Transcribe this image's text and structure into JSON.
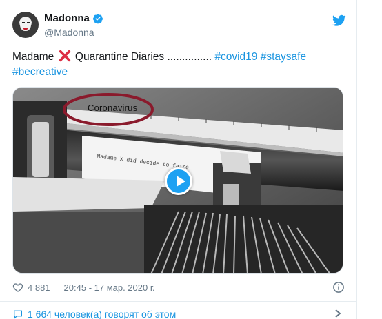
{
  "author": {
    "display_name": "Madonna",
    "handle": "@Madonna",
    "verified": true
  },
  "tweet": {
    "text_before": "Madame ",
    "text_after": " Quarantine Diaries ............... ",
    "hashtags": [
      "#covid19",
      "#staysafe",
      "#becreative"
    ]
  },
  "media": {
    "type": "video",
    "typed_label": "Coronavirus",
    "paper_text": "Madame X did decide to faire"
  },
  "meta": {
    "likes": "4 881",
    "timestamp": "20:45 - 17 мар. 2020 г."
  },
  "footer": {
    "talking_text": "1 664 человек(а) говорят об этом"
  },
  "colors": {
    "link": "#1b95e0",
    "verified": "#1da1f2",
    "x_emoji": "#dd2e44",
    "circle": "#8a1a2c"
  }
}
